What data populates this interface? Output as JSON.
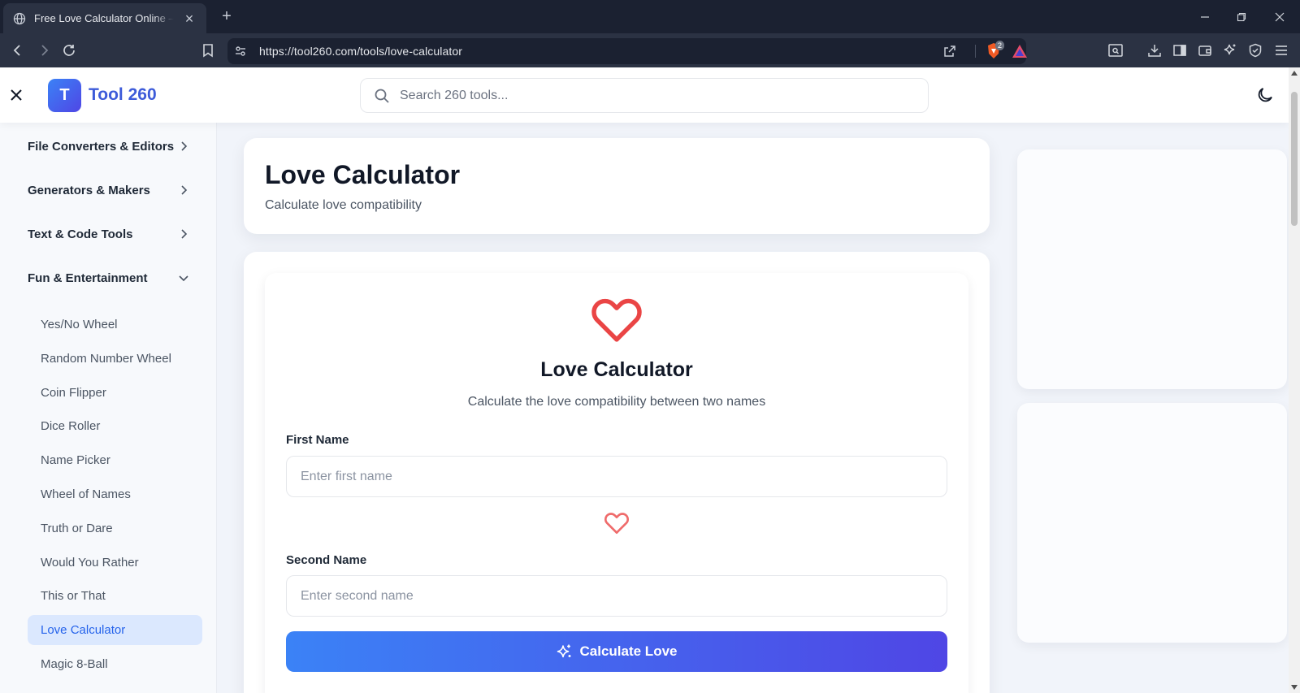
{
  "browser": {
    "tab_title": "Free Love Calculator Online – Calculate Love Compatibility",
    "tab_close": "×",
    "new_tab": "+",
    "url": "https://tool260.com/tools/love-calculator",
    "brave_badge": "2"
  },
  "header": {
    "logo_letter": "T",
    "brand": "Tool 260",
    "search_placeholder": "Search 260 tools..."
  },
  "sidebar": {
    "categories": [
      {
        "label": "File Converters & Editors",
        "expanded": false
      },
      {
        "label": "Generators & Makers",
        "expanded": false
      },
      {
        "label": "Text & Code Tools",
        "expanded": false
      },
      {
        "label": "Fun & Entertainment",
        "expanded": true
      }
    ],
    "items": [
      {
        "label": "Yes/No Wheel",
        "active": false
      },
      {
        "label": "Random Number Wheel",
        "active": false
      },
      {
        "label": "Coin Flipper",
        "active": false
      },
      {
        "label": "Dice Roller",
        "active": false
      },
      {
        "label": "Name Picker",
        "active": false
      },
      {
        "label": "Wheel of Names",
        "active": false
      },
      {
        "label": "Truth or Dare",
        "active": false
      },
      {
        "label": "Would You Rather",
        "active": false
      },
      {
        "label": "This or That",
        "active": false
      },
      {
        "label": "Love Calculator",
        "active": true
      },
      {
        "label": "Magic 8-Ball",
        "active": false
      }
    ]
  },
  "page": {
    "title": "Love Calculator",
    "subtitle": "Calculate love compatibility"
  },
  "tool": {
    "title": "Love Calculator",
    "description": "Calculate the love compatibility between two names",
    "first_label": "First Name",
    "first_placeholder": "Enter first name",
    "first_value": "",
    "second_label": "Second Name",
    "second_placeholder": "Enter second name",
    "second_value": "",
    "button_label": "Calculate Love"
  },
  "colors": {
    "accent": "#3b82f6",
    "accent_end": "#4f46e5",
    "heart": "#ea4545",
    "active_item_bg": "#dbe8fe",
    "brand_text": "#3d5bd9"
  },
  "icons": [
    "globe-icon",
    "back-icon",
    "forward-icon",
    "reload-icon",
    "bookmark-icon",
    "site-info-icon",
    "share-icon",
    "brave-shields-icon",
    "brave-rewards-icon",
    "search-icon",
    "heart-icon",
    "sparkle-icon",
    "moon-icon",
    "close-icon",
    "chevron-right-icon",
    "chevron-down-icon"
  ]
}
